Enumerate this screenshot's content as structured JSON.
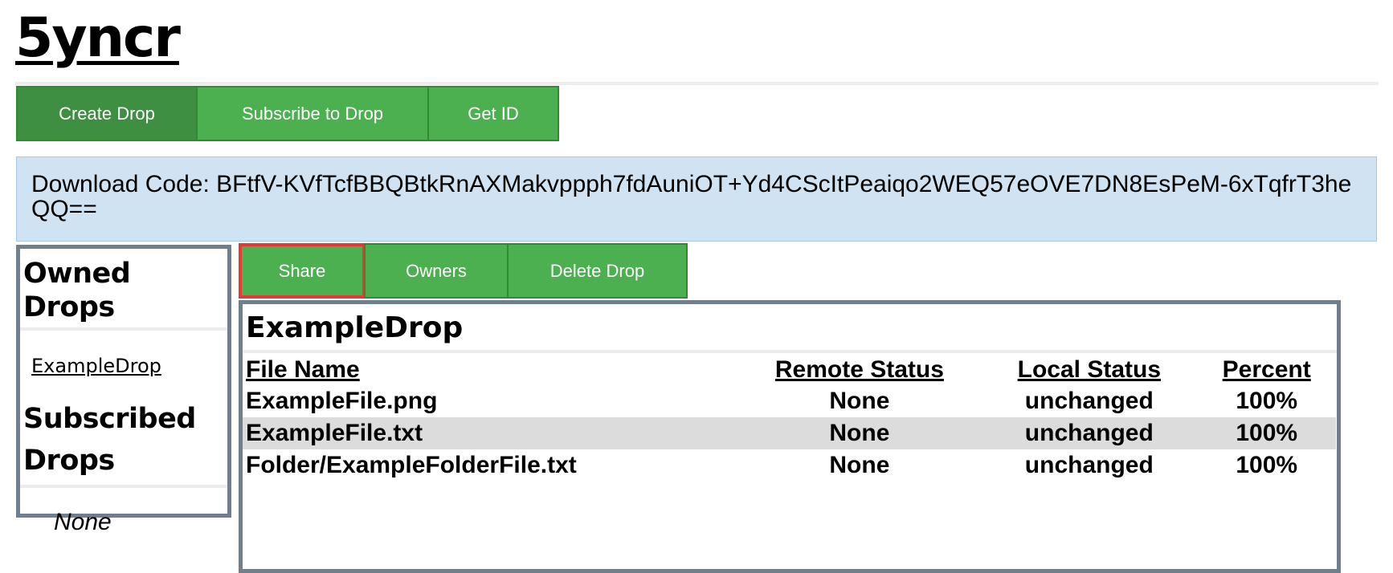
{
  "app": {
    "title": "5yncr"
  },
  "toolbar": {
    "create_label": "Create Drop",
    "subscribe_label": "Subscribe to Drop",
    "getid_label": "Get ID"
  },
  "download": {
    "text": "Download Code: BFtfV-KVfTcfBBQBtkRnAXMakvppph7fdAuniOT+Yd4CScItPeaiqo2WEQ57eOVE7DN8EsPeM-6xTqfrT3heQQ=="
  },
  "sidebar": {
    "owned_title": "Owned Drops",
    "owned_items": [
      "ExampleDrop"
    ],
    "subscribed_title": "Subscribed Drops",
    "subscribed_none": "None"
  },
  "drop_actions": {
    "share_label": "Share",
    "owners_label": "Owners",
    "delete_label": "Delete Drop"
  },
  "drop": {
    "title": "ExampleDrop",
    "columns": [
      "File Name",
      "Remote Status",
      "Local Status",
      "Percent"
    ],
    "rows": [
      [
        "ExampleFile.png",
        "None",
        "unchanged",
        "100%"
      ],
      [
        "ExampleFile.txt",
        "None",
        "unchanged",
        "100%"
      ],
      [
        "Folder/ExampleFolderFile.txt",
        "None",
        "unchanged",
        "100%"
      ]
    ]
  },
  "colors": {
    "button": "#4caf50",
    "button_active": "#3f8f42",
    "highlight_border": "#e53935",
    "code_bg": "#cfe3f2",
    "panel_border": "#6f7f8e",
    "row_alt": "#dcdcdc"
  }
}
